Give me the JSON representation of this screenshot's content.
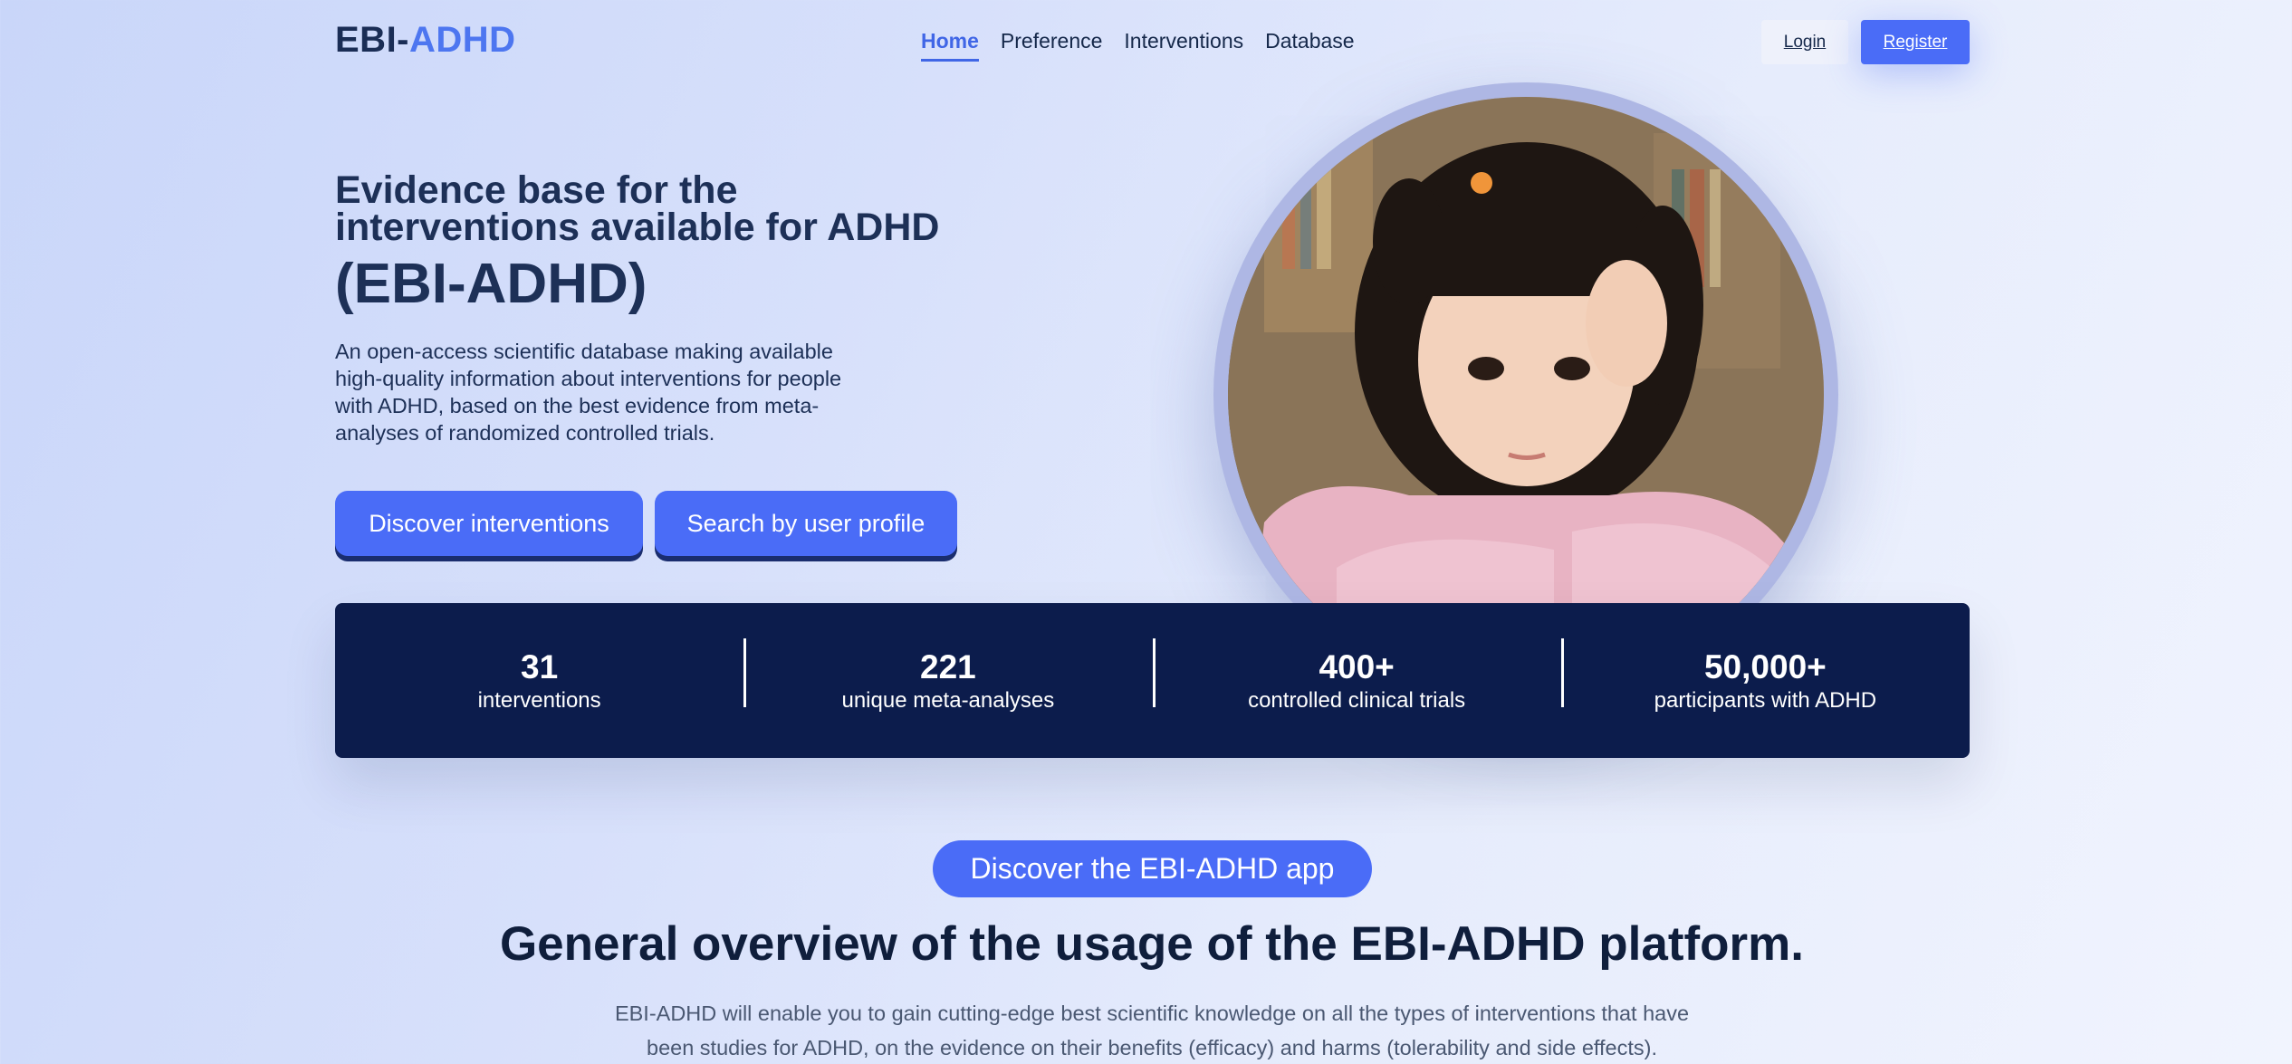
{
  "header": {
    "logo_part1": "EBI-",
    "logo_part2": "ADHD",
    "nav": [
      {
        "label": "Home",
        "active": true
      },
      {
        "label": "Preference",
        "active": false
      },
      {
        "label": "Interventions",
        "active": false
      },
      {
        "label": "Database",
        "active": false
      }
    ],
    "login_label": "Login",
    "register_label": "Register"
  },
  "hero": {
    "title": "Evidence base for the interventions available for ADHD",
    "title_acronym": "(EBI-ADHD)",
    "description": "An open-access scientific database making available high-quality information about interventions for people with ADHD, based on the best evidence from meta-analyses of randomized controlled trials.",
    "buttons": {
      "discover": "Discover interventions",
      "search_profile": "Search by user profile"
    }
  },
  "stats": [
    {
      "value": "31",
      "label": "interventions"
    },
    {
      "value": "221",
      "label": "unique meta-analyses"
    },
    {
      "value": "400+",
      "label": "controlled clinical trials"
    },
    {
      "value": "50,000+",
      "label": "participants with ADHD"
    }
  ],
  "overview": {
    "app_button": "Discover the EBI-ADHD app",
    "title": "General overview of the usage of the EBI-ADHD platform.",
    "text": "EBI-ADHD will enable you to gain cutting-edge best scientific knowledge on all the types of interventions that have been studies for ADHD, on the evidence on their benefits (efficacy) and harms (tolerability and side effects)."
  },
  "colors": {
    "accent": "#4a6cf7",
    "navy": "#0c1c4c",
    "text_dark": "#1d3057"
  }
}
